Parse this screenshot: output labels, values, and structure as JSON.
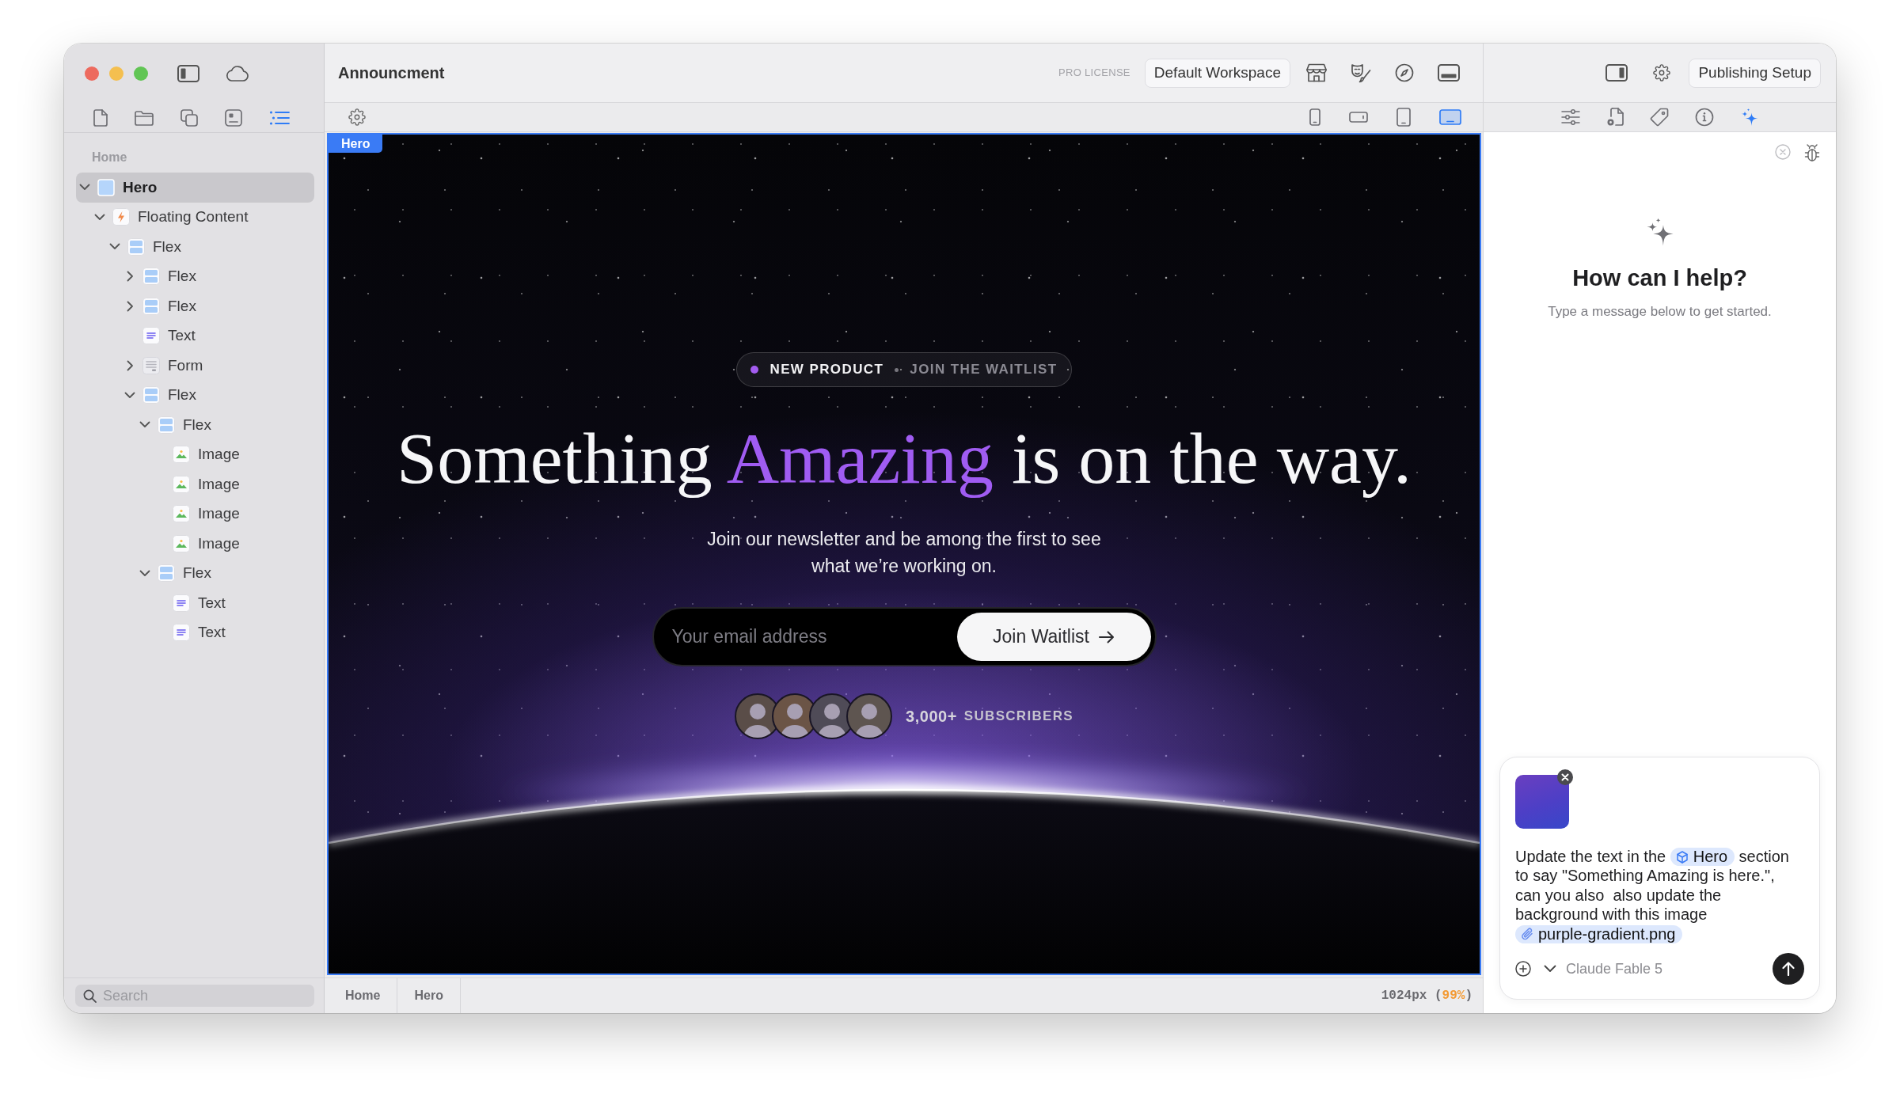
{
  "window": {
    "title": "Announcment",
    "license": "PRO LICENSE",
    "workspace": "Default Workspace"
  },
  "sidebar": {
    "tabs": [
      {
        "kind": "page",
        "selected": false
      },
      {
        "kind": "folder",
        "selected": false
      },
      {
        "kind": "copies",
        "selected": false
      },
      {
        "kind": "media",
        "selected": false
      },
      {
        "kind": "layers",
        "selected": true
      }
    ],
    "page_label": "Home",
    "tree": [
      {
        "label": "Hero",
        "kind": "section",
        "expanded": true,
        "selected": true,
        "children": [
          {
            "label": "Floating Content",
            "kind": "component",
            "expanded": true,
            "selected": false,
            "children": [
              {
                "label": "Flex",
                "kind": "flex",
                "expanded": true,
                "selected": false,
                "children": [
                  {
                    "label": "Flex",
                    "kind": "flex",
                    "expanded": false,
                    "selected": false
                  },
                  {
                    "label": "Flex",
                    "kind": "flex",
                    "expanded": false,
                    "selected": false
                  },
                  {
                    "label": "Text",
                    "kind": "text",
                    "selected": false
                  },
                  {
                    "label": "Form",
                    "kind": "form",
                    "expanded": false,
                    "selected": false
                  },
                  {
                    "label": "Flex",
                    "kind": "flex",
                    "expanded": true,
                    "selected": false,
                    "children": [
                      {
                        "label": "Flex",
                        "kind": "flex",
                        "expanded": true,
                        "selected": false,
                        "children": [
                          {
                            "label": "Image",
                            "kind": "image",
                            "selected": false
                          },
                          {
                            "label": "Image",
                            "kind": "image",
                            "selected": false
                          },
                          {
                            "label": "Image",
                            "kind": "image",
                            "selected": false
                          },
                          {
                            "label": "Image",
                            "kind": "image",
                            "selected": false
                          }
                        ]
                      },
                      {
                        "label": "Flex",
                        "kind": "flex",
                        "expanded": true,
                        "selected": false,
                        "children": [
                          {
                            "label": "Text",
                            "kind": "text",
                            "selected": false
                          },
                          {
                            "label": "Text",
                            "kind": "text",
                            "selected": false
                          }
                        ]
                      }
                    ]
                  }
                ]
              }
            ]
          }
        ]
      }
    ],
    "search": {
      "placeholder": "Search"
    }
  },
  "toolbar": {
    "devices": [
      {
        "kind": "phone",
        "selected": false
      },
      {
        "kind": "phone-landscape",
        "selected": false
      },
      {
        "kind": "tablet",
        "selected": false
      },
      {
        "kind": "desktop",
        "selected": true
      }
    ]
  },
  "canvas": {
    "selection_label": "Hero",
    "badge": {
      "primary": "NEW PRODUCT",
      "secondary": "JOIN THE WAITLIST"
    },
    "heading": [
      {
        "text": "Something ",
        "accent": false
      },
      {
        "text": "Amazing",
        "accent": true
      },
      {
        "text": " is on the way.",
        "accent": false
      }
    ],
    "subtitle": "Join our newsletter and be among the first to see what we’re working on.",
    "email_field": {
      "placeholder": "Your email address"
    },
    "submit_button": "Join Waitlist",
    "subscribers": {
      "count": "3,000+",
      "label": "SUBSCRIBERS"
    }
  },
  "status_bar": {
    "breadcrumbs": [
      "Home",
      "Hero"
    ],
    "readout": [
      {
        "text": "1024px (",
        "accent": false
      },
      {
        "text": "99%",
        "accent": true
      },
      {
        "text": ")",
        "accent": false
      }
    ]
  },
  "inspector": {
    "publish_button": "Publishing Setup",
    "tabs": [
      {
        "kind": "sliders",
        "selected": false
      },
      {
        "kind": "doc-gear",
        "selected": false
      },
      {
        "kind": "tag",
        "selected": false
      },
      {
        "kind": "info",
        "selected": false
      },
      {
        "kind": "sparkle",
        "selected": true
      }
    ],
    "assistant": {
      "title": "How can I help?",
      "subtitle": "Type a message below to get started.",
      "composer": {
        "message": [
          {
            "kind": "text",
            "text": "Update the text in the "
          },
          {
            "kind": "mention",
            "text": "Hero"
          },
          {
            "kind": "text",
            "text": " section to say \"Something Amazing is here.\", can you also  also update the background with this image "
          },
          {
            "kind": "file",
            "text": "purple-gradient.png"
          }
        ],
        "model": "Claude Fable 5"
      }
    }
  }
}
